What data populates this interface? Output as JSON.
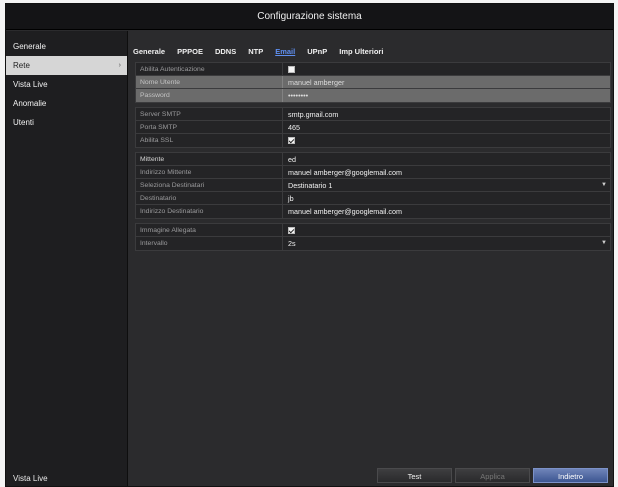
{
  "window": {
    "title": "Configurazione sistema"
  },
  "sidebar": {
    "items": [
      {
        "label": "Generale"
      },
      {
        "label": "Rete",
        "selected": true,
        "chevron": "›"
      },
      {
        "label": "Vista Live"
      },
      {
        "label": "Anomalie"
      },
      {
        "label": "Utenti"
      }
    ],
    "bottom_label": "Vista Live"
  },
  "tabs": [
    {
      "label": "Generale"
    },
    {
      "label": "PPPOE"
    },
    {
      "label": "DDNS"
    },
    {
      "label": "NTP"
    },
    {
      "label": "Email",
      "active": true
    },
    {
      "label": "UPnP"
    },
    {
      "label": "Imp Ulteriori"
    }
  ],
  "form": {
    "auth": {
      "label": "Abilita Autenticazione",
      "checked": false,
      "username_label": "Nome Utente",
      "username_value": "manuel amberger",
      "password_label": "Password",
      "password_value": "••••••••"
    },
    "server": {
      "smtp_label": "Server SMTP",
      "smtp_value": "smtp.gmail.com",
      "port_label": "Porta SMTP",
      "port_value": "465",
      "ssl_label": "Abilita SSL",
      "ssl_checked": true
    },
    "sender": {
      "name_label": "Mittente",
      "name_value": "ed",
      "address_label": "Indirizzo Mittente",
      "address_value": "manuel amberger@googlemail.com",
      "select_label": "Seleziona Destinatari",
      "select_value": "Destinatario 1",
      "recipient_label": "Destinatario",
      "recipient_value": "jb",
      "recipient_address_label": "Indirizzo Destinatario",
      "recipient_address_value": "manuel amberger@googlemail.com"
    },
    "attachment": {
      "label": "Immagine Allegata",
      "checked": true,
      "interval_label": "Intervallo",
      "interval_value": "2s"
    }
  },
  "buttons": {
    "test": "Test",
    "apply": "Applica",
    "back": "Indietro"
  },
  "icons": {
    "dropdown": "dropdown-arrow-icon",
    "chevron": "chevron-right-icon",
    "checkbox": "checkbox-icon"
  },
  "colors": {
    "active_tab": "#5f8ff0",
    "primary_button": "#3d5691",
    "selected_sidebar": "#d6d6d6"
  }
}
